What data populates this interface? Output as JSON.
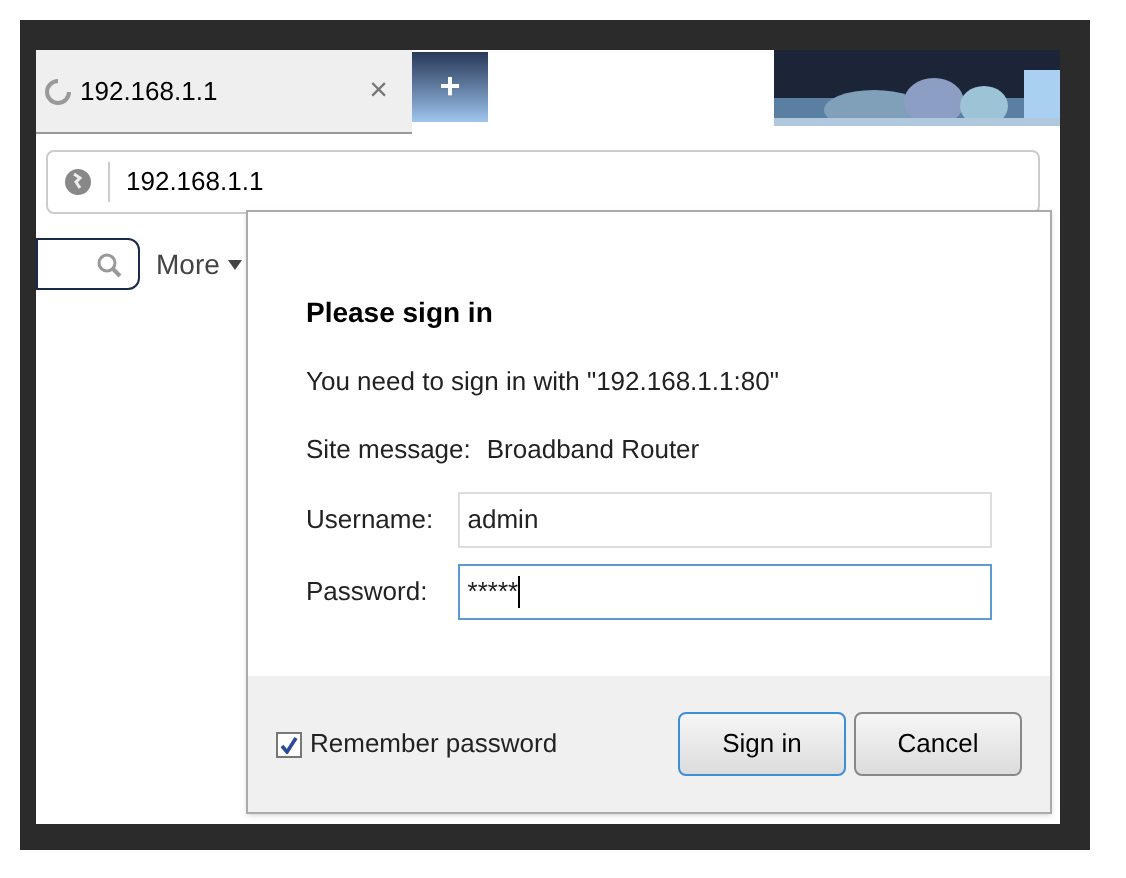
{
  "tab": {
    "title": "192.168.1.1",
    "close": "×",
    "new_tab": "+"
  },
  "address_bar": {
    "url": "192.168.1.1"
  },
  "toolbar": {
    "more": "More"
  },
  "dialog": {
    "title": "Please sign in",
    "message": "You need to sign in with \"192.168.1.1:80\"",
    "site_label": "Site message:",
    "site_message": "Broadband Router",
    "fields": [
      {
        "label": "Username:",
        "value": "admin",
        "focused": false
      },
      {
        "label": "Password:",
        "value": "*****",
        "focused": true
      }
    ],
    "remember": {
      "label": "Remember password",
      "checked": true
    },
    "buttons": [
      {
        "label": "Sign in",
        "primary": true
      },
      {
        "label": "Cancel",
        "primary": false
      }
    ]
  }
}
